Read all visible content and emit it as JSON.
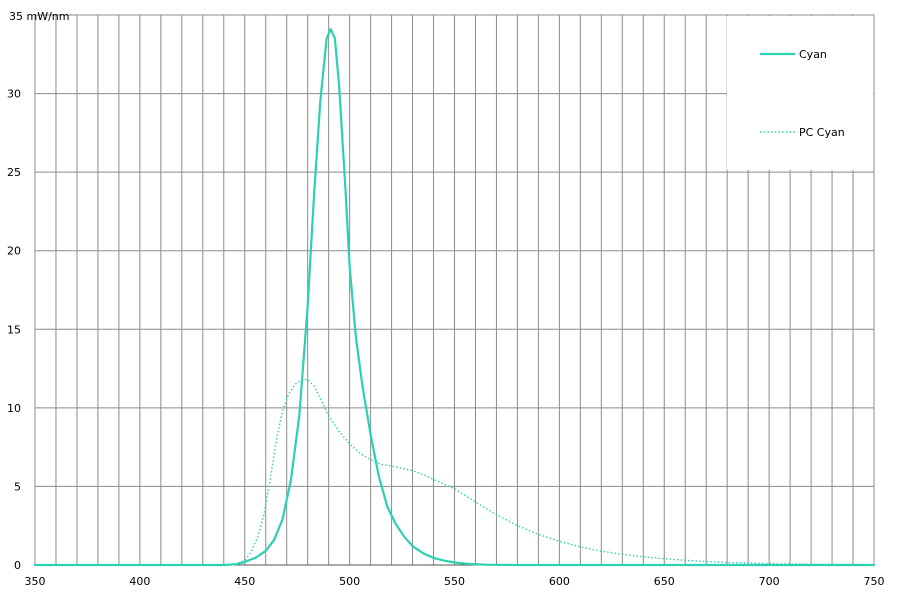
{
  "chart_data": {
    "type": "line",
    "title": "",
    "xlabel": "",
    "ylabel": "mW/nm",
    "xlim": [
      350,
      750
    ],
    "ylim": [
      0,
      35
    ],
    "x_ticks": [
      350,
      400,
      450,
      500,
      550,
      600,
      650,
      700,
      750
    ],
    "x_tick_labels": [
      "350",
      "400",
      "450",
      "500",
      "550",
      "600",
      "650",
      "700",
      "750"
    ],
    "x_minor_step": 10,
    "y_ticks": [
      0,
      5,
      10,
      15,
      20,
      25,
      30,
      35
    ],
    "y_tick_labels": [
      "0",
      "5",
      "10",
      "15",
      "20",
      "25",
      "30",
      "35 mW/nm"
    ],
    "grid": true,
    "legend_position": "top-right",
    "colors": {
      "series": "#2bd1b0",
      "grid": "#8c8c8c"
    },
    "series": [
      {
        "name": "Cyan",
        "style": "solid",
        "x": [
          350,
          400,
          440,
          446,
          450,
          455,
          460,
          464,
          468,
          472,
          476,
          480,
          483,
          486,
          489,
          491,
          493,
          495,
          498,
          500,
          503,
          506,
          510,
          514,
          518,
          522,
          526,
          530,
          535,
          540,
          545,
          550,
          555,
          560,
          565,
          570,
          580,
          600,
          650,
          700,
          750
        ],
        "y": [
          0,
          0,
          0,
          0.05,
          0.2,
          0.45,
          0.9,
          1.6,
          2.9,
          5.4,
          9.5,
          16.5,
          23.5,
          29.5,
          33.5,
          34.1,
          33.5,
          30.5,
          24,
          19,
          14.5,
          11.5,
          8.3,
          5.6,
          3.7,
          2.6,
          1.8,
          1.2,
          0.75,
          0.45,
          0.28,
          0.16,
          0.09,
          0.05,
          0.02,
          0.01,
          0,
          0,
          0,
          0,
          0
        ]
      },
      {
        "name": "PC Cyan",
        "style": "dotted",
        "x": [
          350,
          400,
          440,
          446,
          450,
          453,
          456,
          459,
          462,
          465,
          468,
          471,
          474,
          477,
          480,
          483,
          486,
          490,
          495,
          500,
          505,
          510,
          515,
          520,
          525,
          530,
          535,
          540,
          545,
          550,
          560,
          570,
          580,
          590,
          600,
          610,
          620,
          630,
          640,
          650,
          660,
          670,
          680,
          690,
          700,
          710,
          720,
          730,
          740,
          750
        ],
        "y": [
          0,
          0,
          0,
          0.08,
          0.3,
          0.8,
          1.7,
          3.1,
          5.3,
          7.9,
          9.8,
          10.9,
          11.5,
          11.8,
          11.8,
          11.4,
          10.6,
          9.5,
          8.5,
          7.7,
          7.1,
          6.7,
          6.4,
          6.3,
          6.15,
          6.0,
          5.75,
          5.45,
          5.15,
          4.85,
          4.0,
          3.2,
          2.5,
          1.95,
          1.5,
          1.15,
          0.88,
          0.68,
          0.52,
          0.4,
          0.3,
          0.22,
          0.16,
          0.12,
          0.09,
          0.07,
          0.05,
          0.04,
          0.03,
          0.02
        ]
      }
    ]
  }
}
